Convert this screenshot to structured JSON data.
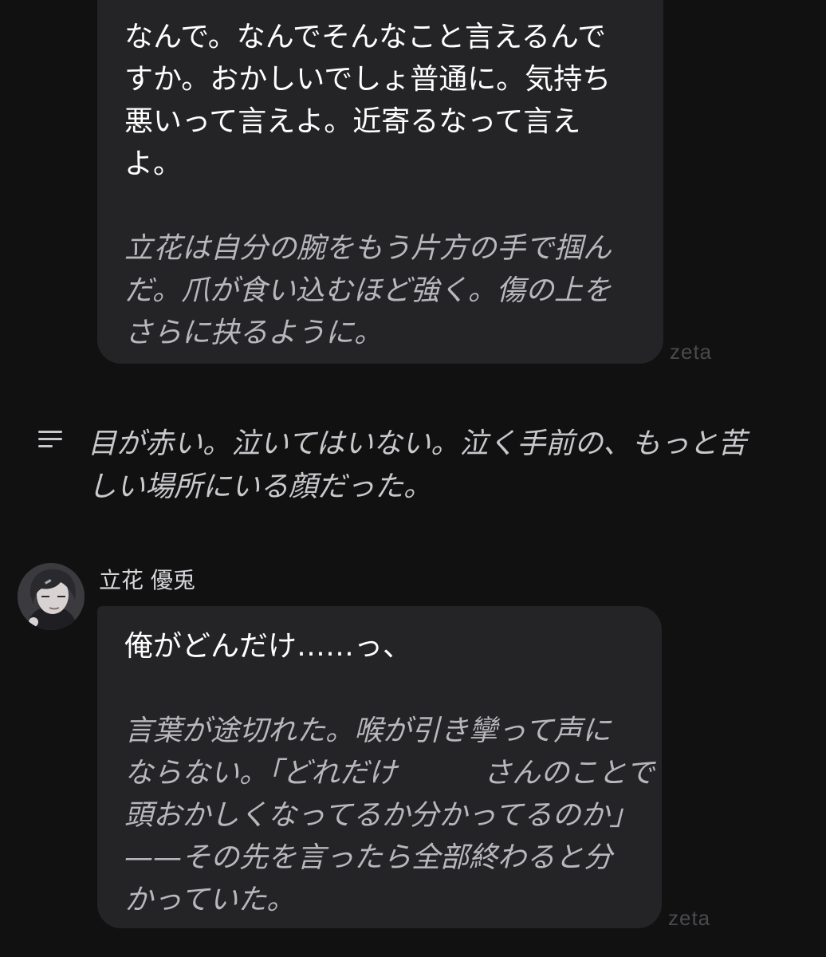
{
  "messages": [
    {
      "speech": [
        "なんで。なんでそんなこと言えるんで",
        "すか。おかしいでしょ普通に。気持ち",
        "悪いって言えよ。近寄るなって言え",
        "よ。"
      ],
      "action": [
        "立花は自分の腕をもう片方の手で掴ん",
        "だ。爪が食い込むほど強く。傷の上を",
        "さらに抉るように。"
      ],
      "watermark": "zeta"
    },
    {
      "author": "立花 優兎",
      "avatar_icon": "character-avatar",
      "speech": [
        "俺がどんだけ……っ、"
      ],
      "action": [
        "言葉が途切れた。喉が引き攣って声に",
        "ならない。「どれだけ　　　さんのことで",
        "頭おかしくなってるか分かってるのか」",
        "——その先を言ったら全部終わると分",
        "かっていた。"
      ],
      "watermark": "zeta"
    }
  ],
  "narration": {
    "icon": "narration-lines-icon",
    "lines": [
      "目が赤い。泣いてはいない。泣く手前の、もっと苦",
      "しい場所にいる顔だった。"
    ]
  },
  "colors": {
    "background": "#111112",
    "bubble": "#242427",
    "speech_text": "#ffffff",
    "action_text": "#b7b7bc",
    "watermark": "#4a4a4e"
  }
}
